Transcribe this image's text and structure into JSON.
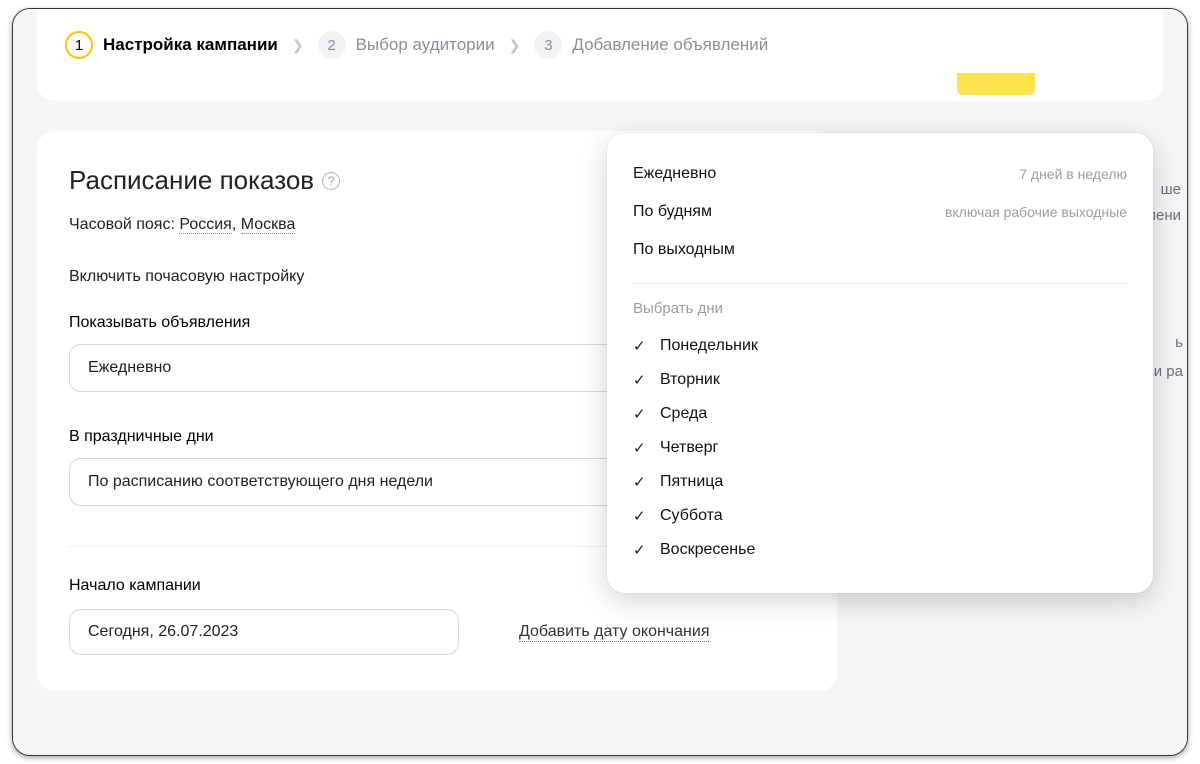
{
  "steps": {
    "s1": {
      "num": "1",
      "label": "Настройка кампании"
    },
    "s2": {
      "num": "2",
      "label": "Выбор аудитории"
    },
    "s3": {
      "num": "3",
      "label": "Добавление объявлений"
    }
  },
  "side": {
    "line1": "ше",
    "line2": "лени",
    "line3": "ь",
    "line4": "и ра"
  },
  "form": {
    "title": "Расписание показов",
    "tz_label": "Часовой пояс:",
    "tz_country": "Россия",
    "tz_city": "Москва",
    "hourly": "Включить почасовую настройку",
    "show_ads_label": "Показывать объявления",
    "show_ads_value": "Ежедневно",
    "holidays_label": "В праздничные дни",
    "holidays_value": "По расписанию соответствующего дня недели",
    "start_label": "Начало кампании",
    "start_value": "Сегодня, 26.07.2023",
    "add_end": "Добавить дату окончания"
  },
  "dropdown": {
    "options": [
      {
        "label": "Ежедневно",
        "hint": "7 дней в неделю"
      },
      {
        "label": "По будням",
        "hint": "включая рабочие выходные"
      },
      {
        "label": "По выходным",
        "hint": ""
      }
    ],
    "subtitle": "Выбрать дни",
    "days": [
      "Понедельник",
      "Вторник",
      "Среда",
      "Четверг",
      "Пятница",
      "Суббота",
      "Воскресенье"
    ]
  }
}
